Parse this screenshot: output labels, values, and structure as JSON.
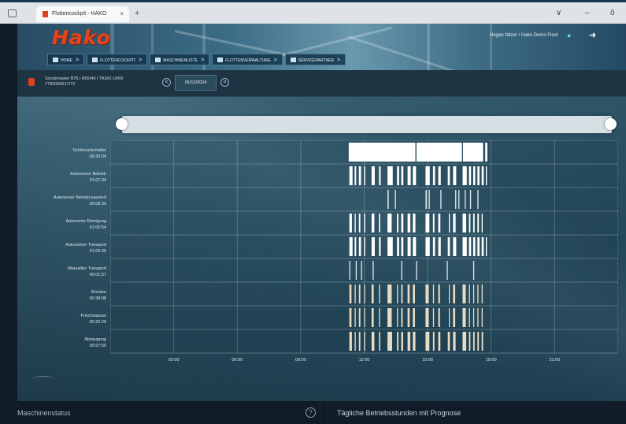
{
  "browser": {
    "tab_title": "Flottencockpit - HAKO",
    "tab_close": "×",
    "new_tab": "+",
    "minimize": "∨",
    "restore": "–",
    "close": "ō"
  },
  "header": {
    "logo": "Hako",
    "user_text": "Hegan Nitzer / Hako Demo Fleet",
    "nav": [
      {
        "label": "HOME",
        "icon": "home-icon"
      },
      {
        "label": "FLOTTENCOCKPIT",
        "icon": "cockpit-icon"
      },
      {
        "label": "MASCHINENLISTE",
        "icon": "list-icon"
      },
      {
        "label": "FLOTTENVERWALTUNG",
        "icon": "fleet-icon"
      },
      {
        "label": "SERVICEPARTNER",
        "icon": "service-icon"
      }
    ],
    "nav_arrow": ">"
  },
  "machine": {
    "name": "Scrubmaster B75 i R55/40 / TASKI LR69",
    "serial": "7783030617/73",
    "date": "05/12/2024",
    "prev": "<",
    "next": ">"
  },
  "chart_data": {
    "type": "timeline",
    "x_ticks": [
      "03:00",
      "06:00",
      "09:00",
      "12:00",
      "15:00",
      "18:00",
      "21:00"
    ],
    "x_range_hours": [
      0,
      24
    ],
    "grid": true,
    "rows": [
      {
        "label": "Schlüsselschalter",
        "duration": "06:30:04",
        "color": "#ffffff",
        "segments": [
          [
            11.27,
            14.42
          ],
          [
            14.47,
            16.62
          ],
          [
            16.67,
            17.62
          ],
          [
            17.72,
            17.82
          ]
        ]
      },
      {
        "label": "Autonomer Betrieb",
        "duration": "01:07:34",
        "color": "#ffffff",
        "segments": [
          [
            11.3,
            11.45
          ],
          [
            11.55,
            11.62
          ],
          [
            11.75,
            11.85
          ],
          [
            12.0,
            12.05
          ],
          [
            12.35,
            12.5
          ],
          [
            12.7,
            12.78
          ],
          [
            13.1,
            13.35
          ],
          [
            13.55,
            13.65
          ],
          [
            13.75,
            13.85
          ],
          [
            14.05,
            14.2
          ],
          [
            14.3,
            14.45
          ],
          [
            14.9,
            15.1
          ],
          [
            15.25,
            15.35
          ],
          [
            15.5,
            15.62
          ],
          [
            15.95,
            16.05
          ],
          [
            16.2,
            16.35
          ],
          [
            16.65,
            16.85
          ],
          [
            16.95,
            17.05
          ],
          [
            17.15,
            17.25
          ],
          [
            17.35,
            17.45
          ],
          [
            17.55,
            17.65
          ],
          [
            17.75,
            17.8
          ]
        ]
      },
      {
        "label": "Autonomer Betrieb pausiert",
        "duration": "00:08:39",
        "color": "#dfe7ec",
        "segments": [
          [
            13.1,
            13.16
          ],
          [
            13.45,
            13.5
          ],
          [
            14.9,
            14.96
          ],
          [
            15.05,
            15.1
          ],
          [
            15.6,
            15.65
          ],
          [
            16.3,
            16.35
          ],
          [
            16.45,
            16.5
          ],
          [
            16.75,
            16.8
          ],
          [
            17.0,
            17.05
          ],
          [
            17.35,
            17.4
          ]
        ]
      },
      {
        "label": "Autonome Reinigung",
        "duration": "01:00:54",
        "color": "#ffffff",
        "segments": [
          [
            11.3,
            11.42
          ],
          [
            11.55,
            11.6
          ],
          [
            11.75,
            11.82
          ],
          [
            12.0,
            12.05
          ],
          [
            12.35,
            12.48
          ],
          [
            12.7,
            12.76
          ],
          [
            13.1,
            13.3
          ],
          [
            13.55,
            13.62
          ],
          [
            13.75,
            13.85
          ],
          [
            14.05,
            14.18
          ],
          [
            14.3,
            14.42
          ],
          [
            14.9,
            15.08
          ],
          [
            15.25,
            15.32
          ],
          [
            15.5,
            15.6
          ],
          [
            16.0,
            16.05
          ],
          [
            16.2,
            16.32
          ],
          [
            16.65,
            16.82
          ],
          [
            16.95,
            17.02
          ],
          [
            17.15,
            17.22
          ],
          [
            17.35,
            17.42
          ],
          [
            17.55,
            17.6
          ]
        ]
      },
      {
        "label": "Autonomer Transport",
        "duration": "01:00:45",
        "color": "#ffffff",
        "segments": [
          [
            11.3,
            11.45
          ],
          [
            11.55,
            11.62
          ],
          [
            11.75,
            11.85
          ],
          [
            12.0,
            12.05
          ],
          [
            12.35,
            12.5
          ],
          [
            12.7,
            12.78
          ],
          [
            13.1,
            13.35
          ],
          [
            13.55,
            13.65
          ],
          [
            13.75,
            13.85
          ],
          [
            14.05,
            14.2
          ],
          [
            14.3,
            14.45
          ],
          [
            14.9,
            15.1
          ],
          [
            15.25,
            15.35
          ],
          [
            15.5,
            15.62
          ],
          [
            15.95,
            16.05
          ],
          [
            16.2,
            16.35
          ],
          [
            16.65,
            16.85
          ],
          [
            16.95,
            17.05
          ],
          [
            17.15,
            17.25
          ],
          [
            17.35,
            17.45
          ],
          [
            17.55,
            17.65
          ],
          [
            17.75,
            17.8
          ]
        ]
      },
      {
        "label": "Manueller Transport",
        "duration": "00:01:57",
        "color": "#dfe7ec",
        "segments": [
          [
            11.3,
            11.35
          ],
          [
            11.6,
            11.65
          ],
          [
            11.85,
            11.9
          ],
          [
            12.4,
            12.45
          ],
          [
            13.75,
            13.8
          ],
          [
            14.45,
            14.5
          ],
          [
            15.9,
            15.95
          ],
          [
            17.15,
            17.2
          ]
        ]
      },
      {
        "label": "Bürsten",
        "duration": "00:38:08",
        "color": "#e7dcc3",
        "segments": [
          [
            11.3,
            11.4
          ],
          [
            11.55,
            11.6
          ],
          [
            11.75,
            11.82
          ],
          [
            12.0,
            12.04
          ],
          [
            12.35,
            12.45
          ],
          [
            12.7,
            12.75
          ],
          [
            13.1,
            13.3
          ],
          [
            13.55,
            13.6
          ],
          [
            13.75,
            13.82
          ],
          [
            14.05,
            14.15
          ],
          [
            14.3,
            14.4
          ],
          [
            14.9,
            15.05
          ],
          [
            15.25,
            15.3
          ],
          [
            15.5,
            15.58
          ],
          [
            16.0,
            16.04
          ],
          [
            16.2,
            16.3
          ],
          [
            16.65,
            16.8
          ],
          [
            16.95,
            17.0
          ],
          [
            17.15,
            17.2
          ],
          [
            17.35,
            17.4
          ],
          [
            17.55,
            17.6
          ]
        ]
      },
      {
        "label": "Frischwasser",
        "duration": "00:32:29",
        "color": "#e7dcc3",
        "segments": [
          [
            11.3,
            11.4
          ],
          [
            11.55,
            11.6
          ],
          [
            11.75,
            11.82
          ],
          [
            12.0,
            12.04
          ],
          [
            12.35,
            12.45
          ],
          [
            12.7,
            12.75
          ],
          [
            13.1,
            13.3
          ],
          [
            13.55,
            13.6
          ],
          [
            13.75,
            13.82
          ],
          [
            14.05,
            14.15
          ],
          [
            14.3,
            14.4
          ],
          [
            14.9,
            15.05
          ],
          [
            15.25,
            15.3
          ],
          [
            15.5,
            15.58
          ],
          [
            16.0,
            16.04
          ],
          [
            16.2,
            16.3
          ],
          [
            16.65,
            16.8
          ],
          [
            16.95,
            17.0
          ],
          [
            17.15,
            17.2
          ],
          [
            17.35,
            17.4
          ],
          [
            17.55,
            17.6
          ]
        ]
      },
      {
        "label": "Absaugung",
        "duration": "00:57:50",
        "color": "#e7dcc3",
        "segments": [
          [
            11.3,
            11.42
          ],
          [
            11.55,
            11.6
          ],
          [
            11.75,
            11.82
          ],
          [
            12.0,
            12.05
          ],
          [
            12.35,
            12.48
          ],
          [
            12.7,
            12.76
          ],
          [
            13.1,
            13.32
          ],
          [
            13.55,
            13.62
          ],
          [
            13.75,
            13.84
          ],
          [
            14.05,
            14.18
          ],
          [
            14.3,
            14.42
          ],
          [
            14.9,
            15.08
          ],
          [
            15.25,
            15.32
          ],
          [
            15.5,
            15.6
          ],
          [
            15.95,
            16.05
          ],
          [
            16.2,
            16.32
          ],
          [
            16.65,
            16.82
          ],
          [
            16.95,
            17.02
          ],
          [
            17.15,
            17.22
          ],
          [
            17.35,
            17.42
          ],
          [
            17.55,
            17.62
          ]
        ]
      }
    ]
  },
  "bottom": {
    "left_title": "Maschinenstatus",
    "help": "?",
    "right_title": "Tägliche Betriebsstunden mit Prognose"
  }
}
